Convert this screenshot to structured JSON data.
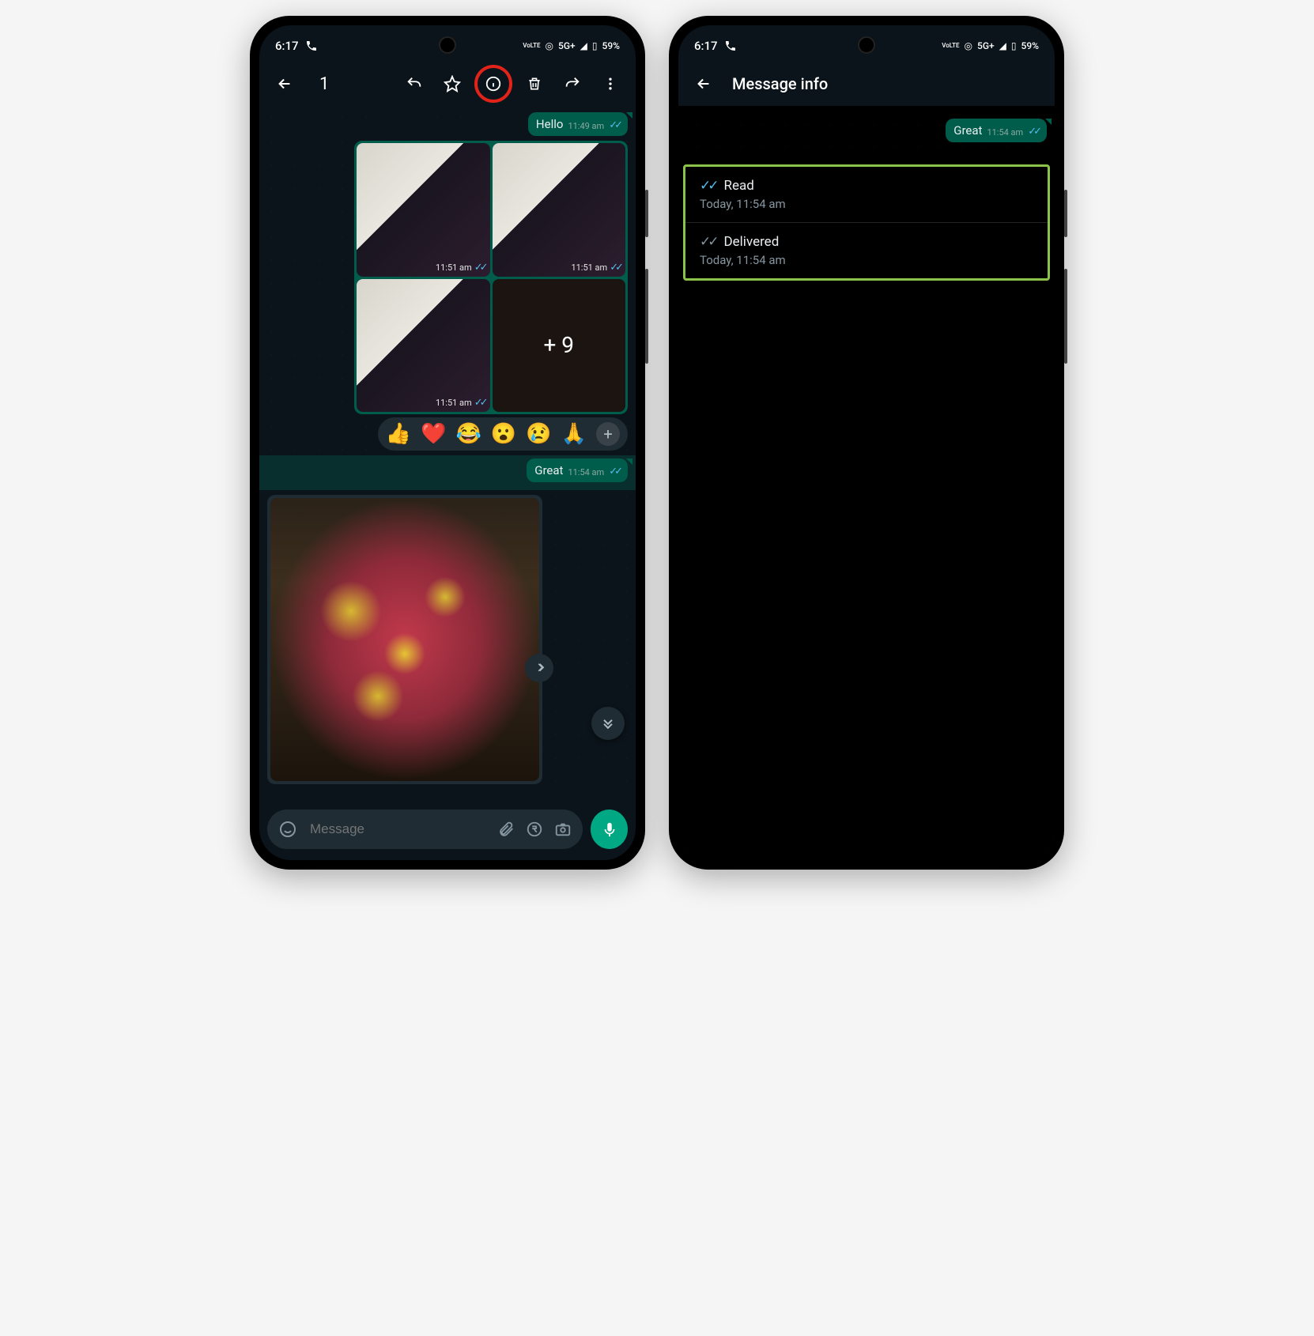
{
  "status_bar": {
    "time": "6:17",
    "network_label": "5G+",
    "volte": "VoLTE",
    "battery_pct": "59%"
  },
  "phone1": {
    "selection_count": "1",
    "hello": {
      "text": "Hello",
      "time": "11:49 am"
    },
    "media": {
      "t1": "11:51 am",
      "t2": "11:51 am",
      "t3": "11:51 am",
      "more_label": "+ 9"
    },
    "reactions": [
      "👍",
      "❤️",
      "😂",
      "😮",
      "😢",
      "🙏"
    ],
    "great": {
      "text": "Great",
      "time": "11:54 am"
    },
    "input_placeholder": "Message"
  },
  "phone2": {
    "title": "Message info",
    "great": {
      "text": "Great",
      "time": "11:54 am"
    },
    "read": {
      "label": "Read",
      "sub": "Today, 11:54 am"
    },
    "delivered": {
      "label": "Delivered",
      "sub": "Today, 11:54 am"
    }
  }
}
